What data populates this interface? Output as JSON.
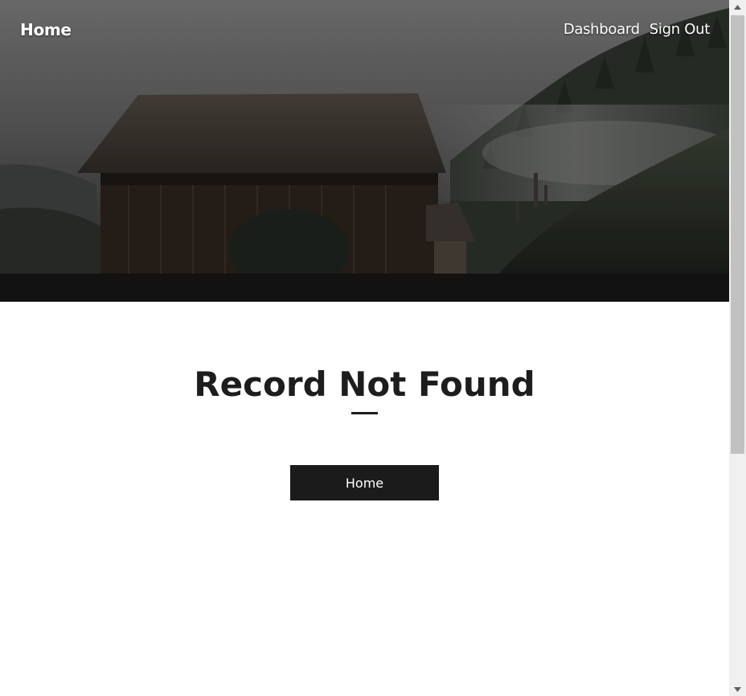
{
  "header": {
    "brand": "Home",
    "nav": [
      "Dashboard",
      "Sign Out"
    ]
  },
  "hero": {
    "image": "misty wooden barn on a forested hillside"
  },
  "main": {
    "title": "Record Not Found",
    "button_label": "Home"
  },
  "scrollbar": {
    "up_icon": "chevron-up-icon",
    "down_icon": "chevron-down-icon"
  },
  "colors": {
    "title_text": "#1d1d1d",
    "button_bg": "#1b1b1b",
    "button_text": "#ffffff",
    "nav_text": "#ffffff",
    "scroll_thumb": "#c1c1c1",
    "scroll_track": "#f0f0f0"
  }
}
